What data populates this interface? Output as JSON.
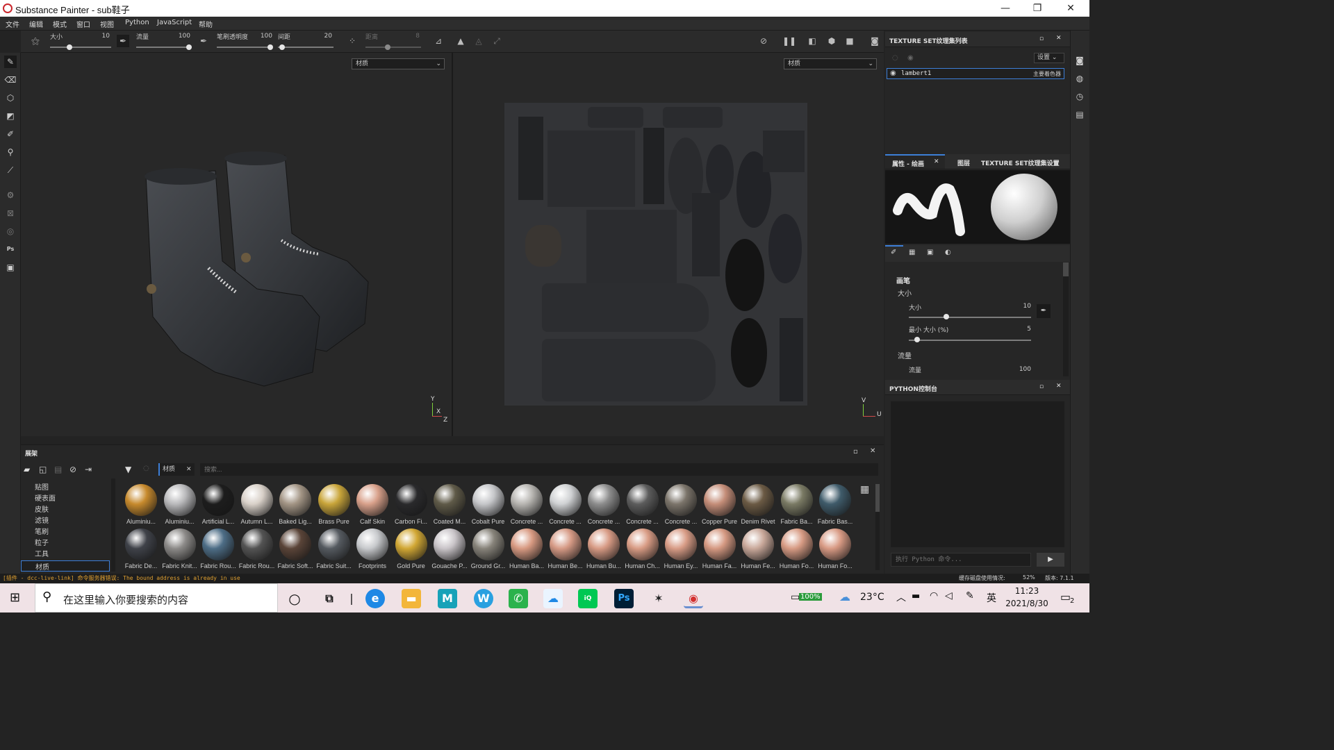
{
  "window": {
    "title": "Substance Painter - sub鞋子",
    "controls": [
      "—",
      "❐",
      "✕"
    ]
  },
  "menu": [
    "文件",
    "编辑",
    "模式",
    "窗口",
    "视图",
    "Python",
    "JavaScript",
    "帮助"
  ],
  "toolbar": {
    "size_label": "大小",
    "size_value": "10",
    "flow_label": "流量",
    "flow_value": "100",
    "opacity_label": "笔刷透明度",
    "opacity_value": "100",
    "spacing_label": "间距",
    "spacing_value": "20",
    "distance_label": "距离",
    "distance_value": "8"
  },
  "viewport3d": {
    "channel_select": "材质",
    "axis_x": "X",
    "axis_y": "Y",
    "axis_z": "Z"
  },
  "viewport2d": {
    "channel_select": "材质",
    "axis_u": "U",
    "axis_v": "V"
  },
  "texture_set_list": {
    "title": "TEXTURE SET纹理集列表",
    "settings_label": "设置",
    "item_name": "lambert1",
    "item_shader": "主要着色器"
  },
  "properties": {
    "tabs": [
      "属性 - 绘画",
      "图层",
      "TEXTURE SET纹理集设置"
    ],
    "brush_section": "画笔",
    "size_group": "大小",
    "size_label": "大小",
    "size_value": "10",
    "min_size_label": "最小 大小 (%)",
    "min_size_value": "5",
    "flow_group": "流量",
    "flow_label": "流量",
    "flow_value": "100"
  },
  "python_console": {
    "title": "PYTHON控制台",
    "placeholder": "执行 Python 命令..."
  },
  "shelf": {
    "title": "展架",
    "categories": [
      "贴图",
      "硬表面",
      "皮肤",
      "滤镜",
      "笔刷",
      "粒子",
      "工具",
      "材质"
    ],
    "selected_category": "材质",
    "filter_tag": "材质",
    "search_placeholder": "搜索...",
    "materials_row1": [
      {
        "name": "Aluminiu...",
        "color": "#c78a2d"
      },
      {
        "name": "Aluminiu...",
        "color": "#b9b9bb"
      },
      {
        "name": "Artificial L...",
        "color": "#1d1d1d"
      },
      {
        "name": "Autumn L...",
        "color": "#d8d0c8"
      },
      {
        "name": "Baked Lig...",
        "color": "#a39585"
      },
      {
        "name": "Brass Pure",
        "color": "#c9a53a"
      },
      {
        "name": "Calf Skin",
        "color": "#d8a08a"
      },
      {
        "name": "Carbon Fi...",
        "color": "#2a2a2c"
      },
      {
        "name": "Coated M...",
        "color": "#5f5a48"
      },
      {
        "name": "Cobalt Pure",
        "color": "#c5c6c9"
      },
      {
        "name": "Concrete ...",
        "color": "#b7b5b1"
      },
      {
        "name": "Concrete ...",
        "color": "#cfd1d3"
      },
      {
        "name": "Concrete ...",
        "color": "#8d8d8d"
      },
      {
        "name": "Concrete ...",
        "color": "#5c5c5c"
      },
      {
        "name": "Concrete ...",
        "color": "#7b746a"
      },
      {
        "name": "Copper Pure",
        "color": "#c48d78"
      },
      {
        "name": "Denim Rivet",
        "color": "#6b5a44"
      },
      {
        "name": "Fabric Ba...",
        "color": "#7a7a64"
      },
      {
        "name": "Fabric Bas...",
        "color": "#3f5b6a"
      }
    ],
    "materials_row2": [
      {
        "name": "Fabric De...",
        "color": "#3f4249"
      },
      {
        "name": "Fabric Knit...",
        "color": "#8c8a88"
      },
      {
        "name": "Fabric Rou...",
        "color": "#4d6d86"
      },
      {
        "name": "Fabric Rou...",
        "color": "#535353"
      },
      {
        "name": "Fabric Soft...",
        "color": "#5a4438"
      },
      {
        "name": "Fabric Suit...",
        "color": "#555a60"
      },
      {
        "name": "Footprints",
        "color": "#c7c9cc"
      },
      {
        "name": "Gold Pure",
        "color": "#d1a734"
      },
      {
        "name": "Gouache P...",
        "color": "#c9c4c8"
      },
      {
        "name": "Ground Gr...",
        "color": "#87837a"
      },
      {
        "name": "Human Ba...",
        "color": "#d89a82"
      },
      {
        "name": "Human Be...",
        "color": "#d69a85"
      },
      {
        "name": "Human Bu...",
        "color": "#d79a84"
      },
      {
        "name": "Human Ch...",
        "color": "#d89b84"
      },
      {
        "name": "Human Ey...",
        "color": "#d89c86"
      },
      {
        "name": "Human Fa...",
        "color": "#d59982"
      },
      {
        "name": "Human Fe...",
        "color": "#c9a89a"
      },
      {
        "name": "Human Fo...",
        "color": "#d79b84"
      },
      {
        "name": "Human Fo...",
        "color": "#d89a84"
      }
    ]
  },
  "status": {
    "message": "[插件 - dcc-live-link] 命令服务器错误: The bound address is already in use",
    "cache_label": "缓存磁盘使用情况:",
    "cache_value": "52%",
    "version": "版本: 7.1.1"
  },
  "taskbar": {
    "search_placeholder": "在这里输入你要搜索的内容",
    "battery": "100%",
    "temperature": "23°C",
    "ime": "英",
    "time": "11:23",
    "date": "2021/8/30",
    "notifications": "2"
  },
  "colors": {
    "accent_blue": "#3d7fd8",
    "panel_bg": "#262626",
    "taskbar_bg": "#f0e2e6",
    "status_warning": "#e0a030"
  }
}
